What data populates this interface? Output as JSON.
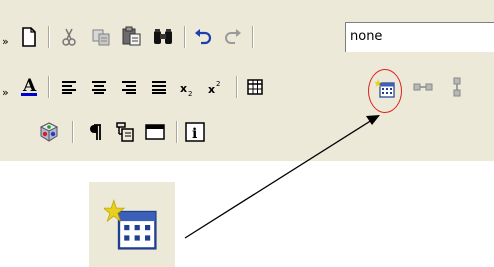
{
  "toolbar": {
    "style_select": {
      "value": "none"
    },
    "rows": [
      {
        "handle": "»",
        "buttons": [
          {
            "name": "new-document-button",
            "icon": "new-document-icon"
          },
          {
            "name": "cut-button",
            "icon": "scissors-icon"
          },
          {
            "name": "copy-button",
            "icon": "copy-icon"
          },
          {
            "name": "paste-button",
            "icon": "clipboard-icon"
          },
          {
            "name": "find-button",
            "icon": "binoculars-icon"
          },
          {
            "name": "undo-button",
            "icon": "undo-icon"
          },
          {
            "name": "redo-button",
            "icon": "redo-icon"
          }
        ]
      },
      {
        "handle": "»",
        "buttons": [
          {
            "name": "font-color-button",
            "icon": "text-color-icon",
            "accent": "#0000cc"
          },
          {
            "name": "align-left-button",
            "icon": "align-left-icon"
          },
          {
            "name": "align-center-button",
            "icon": "align-center-icon"
          },
          {
            "name": "align-right-button",
            "icon": "align-right-icon"
          },
          {
            "name": "justify-button",
            "icon": "justify-icon"
          },
          {
            "name": "subscript-button",
            "icon": "subscript-icon"
          },
          {
            "name": "superscript-button",
            "icon": "superscript-icon"
          },
          {
            "name": "insert-table-button",
            "icon": "table-icon"
          },
          {
            "name": "table-properties-button",
            "icon": "table-wizard-icon",
            "highlighted": true
          },
          {
            "name": "insert-row-button",
            "icon": "row-icon"
          },
          {
            "name": "insert-column-button",
            "icon": "column-icon"
          }
        ]
      },
      {
        "handle": "",
        "buttons": [
          {
            "name": "toggle-3d-button",
            "icon": "cube-icon"
          },
          {
            "name": "show-paragraph-marks-button",
            "icon": "pilcrow-icon"
          },
          {
            "name": "toggle-borders-button",
            "icon": "borders-icon"
          },
          {
            "name": "full-screen-button",
            "icon": "window-icon"
          },
          {
            "name": "info-button",
            "icon": "info-icon"
          }
        ]
      }
    ],
    "highlight_color": "#e02020",
    "background_color": "#ece9d8"
  },
  "zoom": {
    "icon": "table-wizard-icon"
  }
}
